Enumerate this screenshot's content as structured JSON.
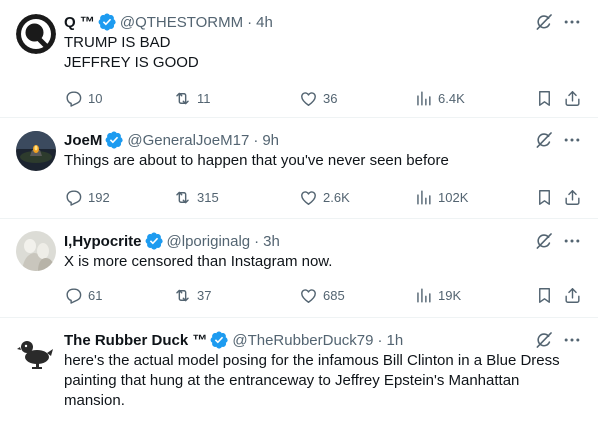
{
  "colors": {
    "accent": "#1d9bf0",
    "text": "#0f1419",
    "muted": "#536471",
    "divider": "#eff3f4"
  },
  "tweets": [
    {
      "name": "Q ™",
      "handle": "@QTHESTORMM",
      "sep": "·",
      "time": "4h",
      "text": "TRUMP IS BAD\nJEFFREY IS GOOD",
      "replies": "10",
      "retweets": "11",
      "likes": "36",
      "views": "6.4K"
    },
    {
      "name": "JoeM",
      "handle": "@GeneralJoeM17",
      "sep": "·",
      "time": "9h",
      "text": "Things are about to happen that you've never seen before",
      "replies": "192",
      "retweets": "315",
      "likes": "2.6K",
      "views": "102K"
    },
    {
      "name": "I,Hypocrite",
      "handle": "@lporiginalg",
      "sep": "·",
      "time": "3h",
      "text": "X is more censored than Instagram now.",
      "replies": "61",
      "retweets": "37",
      "likes": "685",
      "views": "19K"
    },
    {
      "name": "The Rubber Duck ™",
      "handle": "@TheRubberDuck79",
      "sep": "·",
      "time": "1h",
      "text": "here's the actual model posing for the infamous Bill Clinton in a Blue Dress painting that hung at the entranceway to Jeffrey Epstein's Manhattan mansion."
    }
  ]
}
